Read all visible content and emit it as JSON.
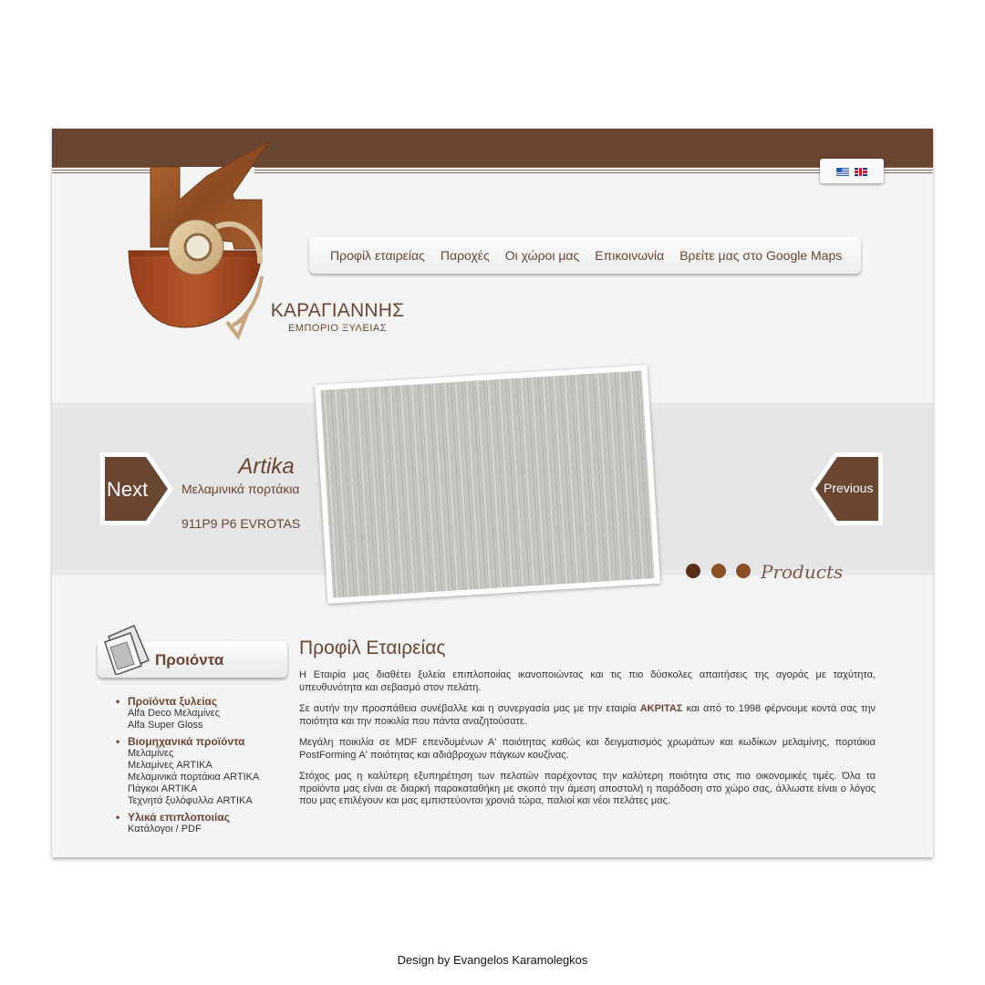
{
  "brand": {
    "name": "ΚΑΡΑΓΙΑΝΝΗΣ",
    "subtitle": "ΕΜΠΟΡΙΟ ΞΥΛΕΙΑΣ"
  },
  "nav": [
    "Προφίλ εταιρείας",
    "Παροχές",
    "Οι χώροι μας",
    "Επικοινωνία",
    "Βρείτε μας στο Google Maps"
  ],
  "languages": [
    "greek-flag-icon",
    "english-flag-icon"
  ],
  "slider": {
    "next_label": "Next",
    "previous_label": "Previous",
    "title": "Artika",
    "subtitle": "Μελαμινικά πορτάκια",
    "code": "911P9 P6 EVROTAS",
    "section_label": "Products",
    "slide_count": 3,
    "active_slide": 1
  },
  "sidebar": {
    "title": "Προιόντα",
    "categories": [
      {
        "label": "Προϊόντα ξυλείας",
        "items": [
          "Alfa Deco Μελαμίνες",
          "Alfa Super Gloss"
        ]
      },
      {
        "label": "Βιομηχανικά προϊόντα",
        "items": [
          "Μελαμίνες",
          "Μελαμίνες ARTIKA",
          "Μελαμινικά πορτάκια ARTIKA",
          "Πάγκοι ARTIKA",
          "Τεχνητά ξυλόφυλλα ARTIKA"
        ]
      },
      {
        "label": "Υλικά επιπλοποιίας",
        "items": [
          "Κατάλογοι / PDF"
        ]
      }
    ]
  },
  "main": {
    "title": "Προφίλ Εταιρείας",
    "p1": "Η Εταιρία μας διαθέτει ξυλεία επιπλοποιίας ικανοποιώντας και τις πιο δύσκολες απαιτήσεις της αγοράς με ταχύτητα, υπευθυνότητα και σεβασμό στον πελάτη.",
    "p2_before": "Σε αυτήν την προσπάθεια συνέβαλλε και η συνεργασία μας με την εταιρία ",
    "p2_strong": "ΑΚΡΙΤΑΣ",
    "p2_after": " και από το 1998 φέρνουμε κοντά σας την ποιότητα και την ποικιλία που πάντα αναζητούσατε.",
    "p3": "Μεγάλη ποικιλία σε MDF επενδυμένων Α' ποιότητας καθώς και δειγματισμός χρωμάτων και κωδίκων μελαμίνης, πορτάκια PostForming Α' ποιότητας και αδιάβροχων πάγκων κουζίνας.",
    "p4": "Στόχος μας η καλύτερη εξυπηρέτηση των πελατών παρέχοντας την καλύτερη ποιότητα στις πιο οικονομικές τιμές. Όλα τα προϊόντα μας είναι σε διαρκή παρακαταθήκη με σκοπό την άμεση αποστολή η παράδοση στο χώρο σας, άλλωστε είναι ο λόγος που μας επιλέγουν και μας εμπιστεύονται χρονιά τώρα, παλιοί και νέοι πελάτες μας."
  },
  "footer": {
    "credit": "Design by Evangelos Karamolegkos"
  },
  "colors": {
    "brand_brown": "#6a4532",
    "dot_dark": "#5a2e18",
    "dot": "#8a4f28"
  }
}
